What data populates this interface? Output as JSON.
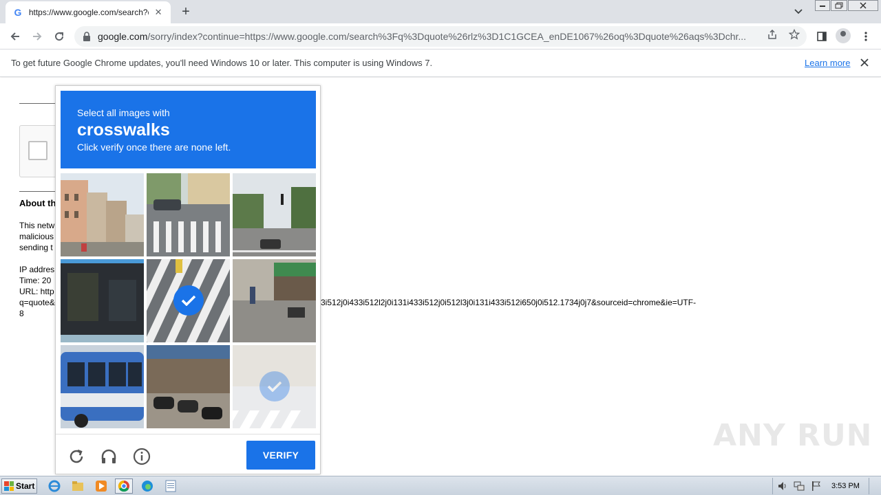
{
  "browser": {
    "tab": {
      "favicon": "G",
      "title": "https://www.google.com/search?q=",
      "close": "✕"
    },
    "new_tab": "+",
    "url": {
      "host": "google.com",
      "rest": "/sorry/index?continue=https://www.google.com/search%3Fq%3Dquote%26rlz%3D1C1GCEA_enDE1067%26oq%3Dquote%26aqs%3Dchr..."
    }
  },
  "infobar": {
    "message": "To get future Google Chrome updates, you'll need Windows 10 or later. This computer is using Windows 7.",
    "link": "Learn more"
  },
  "page": {
    "about_heading": "About th",
    "paragraph": [
      "This netw",
      "malicious",
      "sending t"
    ],
    "ip_label": "IP addres",
    "time_label": "Time: 20",
    "url_label": "URL: http",
    "url_line2_start": "q=quote&",
    "url_line2_rest": "3i512j0i433i512l2j0i131i433i512j0i512l3j0i131i433i512i650j0i512.1734j0j7&sourceid=chrome&ie=UTF-",
    "url_line3": "8"
  },
  "captcha": {
    "line1": "Select all images with",
    "target": "crosswalks",
    "line3": "Click verify once there are none left.",
    "verify": "VERIFY",
    "tiles": [
      {
        "selected": false,
        "faded": false
      },
      {
        "selected": false,
        "faded": false
      },
      {
        "selected": false,
        "faded": false
      },
      {
        "selected": false,
        "faded": false
      },
      {
        "selected": true,
        "faded": false
      },
      {
        "selected": false,
        "faded": false
      },
      {
        "selected": false,
        "faded": false
      },
      {
        "selected": false,
        "faded": false
      },
      {
        "selected": true,
        "faded": true
      }
    ]
  },
  "watermark": "ANY RUN",
  "taskbar": {
    "start": "Start",
    "clock": "3:53 PM"
  },
  "colors": {
    "accent": "#1a73e8",
    "tabstrip": "#dee1e6"
  }
}
